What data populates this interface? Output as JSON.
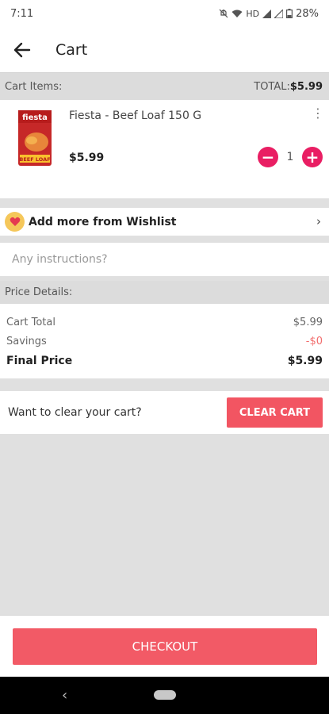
{
  "status_bar": {
    "time": "7:11",
    "network": "HD",
    "battery": "28%"
  },
  "app_bar": {
    "title": "Cart",
    "back_icon": "arrow-left-icon"
  },
  "cart_header": {
    "label": "Cart Items:",
    "total_label": "TOTAL:",
    "total_value": "$5.99"
  },
  "items": [
    {
      "name": "Fiesta - Beef Loaf 150 G",
      "price": "$5.99",
      "quantity": "1",
      "thumb_brand": "fiesta",
      "thumb_text": "BEEF LOAF"
    }
  ],
  "wishlist": {
    "label": "Add more from Wishlist",
    "icon": "heart-icon"
  },
  "instructions": {
    "placeholder": "Any instructions?"
  },
  "price_details": {
    "header": "Price Details:",
    "rows": [
      {
        "label": "Cart Total",
        "value": "$5.99"
      },
      {
        "label": "Savings",
        "value": "-$0"
      }
    ],
    "final_label": "Final Price",
    "final_value": "$5.99"
  },
  "clear_cart": {
    "prompt": "Want to clear your cart?",
    "button": "CLEAR CART"
  },
  "checkout": {
    "button": "CHECKOUT"
  },
  "colors": {
    "accent": "#e91e63",
    "button": "#f25562",
    "wishlist_badge": "#f5c75a"
  }
}
